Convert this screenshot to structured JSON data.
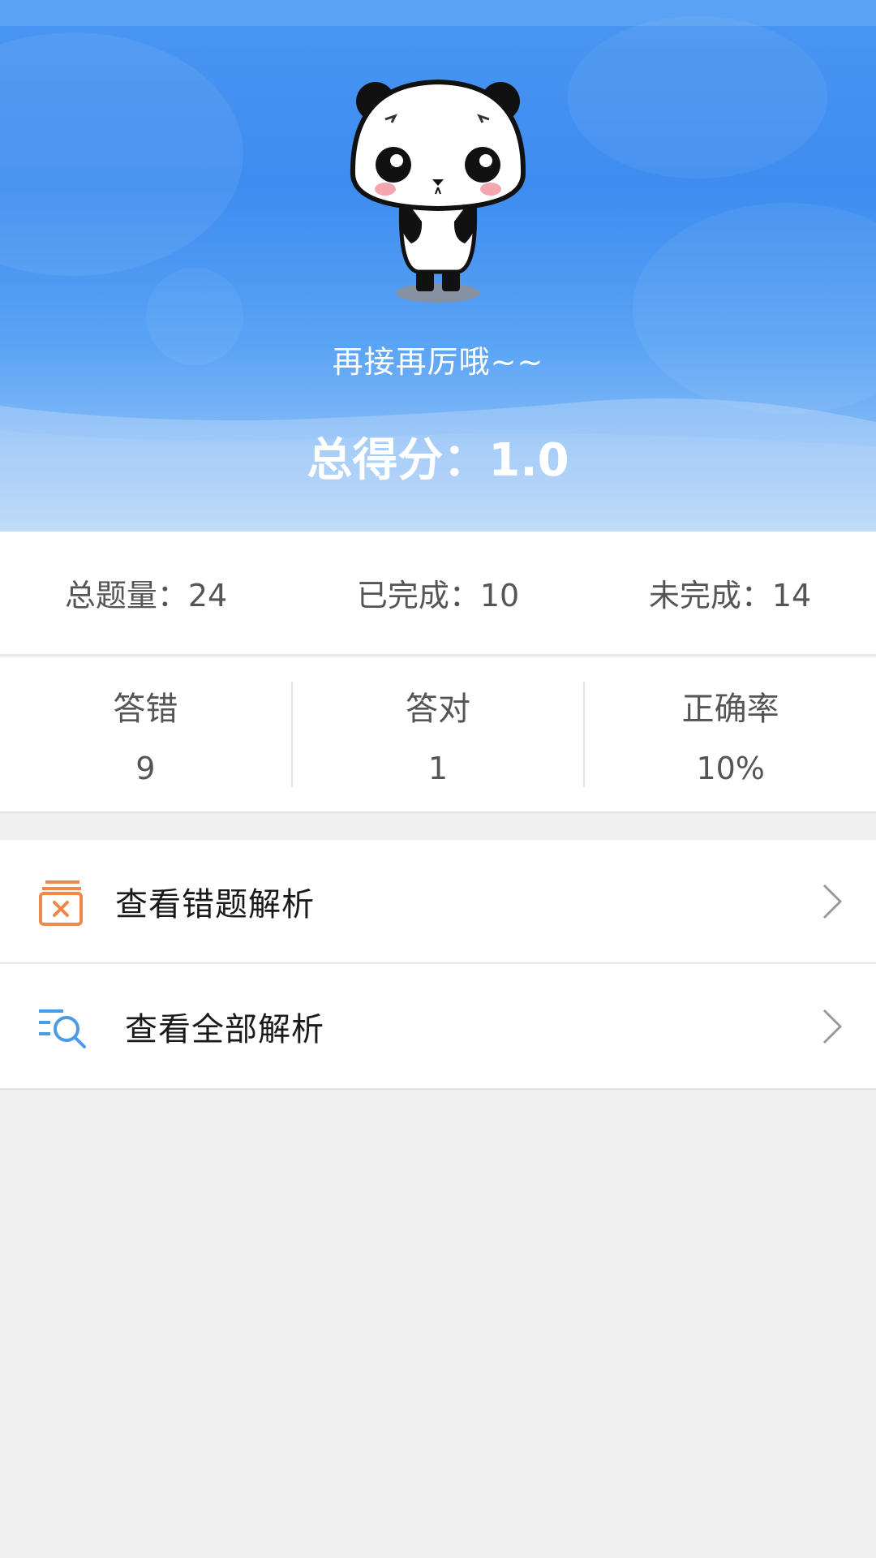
{
  "header": {
    "motto": "再接再厉哦~~",
    "total_score_label": "总得分：",
    "total_score_value": "1.0",
    "mascot_icon": "panda-mascot-icon",
    "gradient_top": "#3d8cf0",
    "gradient_bottom": "#a9cdf8"
  },
  "summary": {
    "total": "总题量：24",
    "completed": "已完成：10",
    "incomplete": "未完成：14"
  },
  "results": [
    {
      "label": "答错",
      "value": "9"
    },
    {
      "label": "答对",
      "value": "1"
    },
    {
      "label": "正确率",
      "value": "10%"
    }
  ],
  "menu": [
    {
      "label": "查看错题解析",
      "icon": "wrong-answers-book-icon",
      "icon_color": "#f0884a"
    },
    {
      "label": "查看全部解析",
      "icon": "list-search-icon",
      "icon_color": "#4a9be8"
    }
  ]
}
